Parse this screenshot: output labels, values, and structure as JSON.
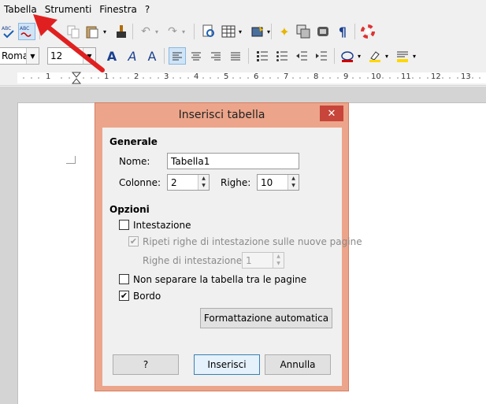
{
  "menubar": {
    "items": [
      "Tabella",
      "Strumenti",
      "Finestra",
      "?"
    ]
  },
  "toolbar2": {
    "font_name": "Roman",
    "font_size": "12"
  },
  "ruler": {
    "numbers": [
      "1",
      "1",
      "2",
      "3",
      "4",
      "5",
      "6",
      "7",
      "8",
      "9",
      "10",
      "11",
      "12",
      "13"
    ]
  },
  "dialog": {
    "title": "Inserisci tabella",
    "close_label": "✕",
    "general": {
      "heading": "Generale",
      "name_label": "Nome:",
      "name_value": "Tabella1",
      "columns_label": "Colonne:",
      "columns_value": "2",
      "rows_label": "Righe:",
      "rows_value": "10"
    },
    "options": {
      "heading": "Opzioni",
      "header_label": "Intestazione",
      "header_checked": false,
      "repeat_label": "Ripeti righe di intestazione sulle nuove pagine",
      "repeat_checked": true,
      "header_rows_label": "Righe di intestazione:",
      "header_rows_value": "1",
      "no_split_label": "Non separare la tabella tra le pagine",
      "no_split_checked": false,
      "border_label": "Bordo",
      "border_checked": true
    },
    "autoformat_label": "Formattazione automatica",
    "help_label": "?",
    "insert_label": "Inserisci",
    "cancel_label": "Annulla"
  },
  "colors": {
    "dialog_frame": "#eca58a",
    "close_button": "#c7453a",
    "annotation_arrow": "#e02020"
  }
}
